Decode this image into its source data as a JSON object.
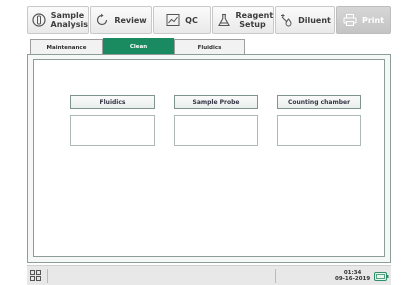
{
  "toolbar": {
    "sample_analysis": "Sample Analysis",
    "review": "Review",
    "qc": "QC",
    "reagent_setup": "Reagent Setup",
    "diluent": "Diluent",
    "print": "Print"
  },
  "tabs": [
    "Maintenance",
    "Clean",
    "Fluidics"
  ],
  "clean": {
    "categories": [
      "Fluidics",
      "Sample Probe",
      "Counting chamber"
    ]
  },
  "status": {
    "time": "01:34",
    "date": "09-16-2019"
  },
  "colors": {
    "accent": "#1a8a61",
    "frame_border": "#8d9e98"
  }
}
